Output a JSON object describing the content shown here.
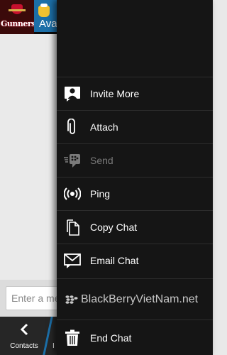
{
  "header": {
    "avatar_text": "Gunners",
    "contact_name": "Avai"
  },
  "composer": {
    "placeholder": "Enter a me"
  },
  "bottom_bar": {
    "back_label": "Contacts",
    "next_label": "I"
  },
  "menu": {
    "items": [
      {
        "label": "Invite More",
        "icon": "invite-contact-icon",
        "enabled": true
      },
      {
        "label": "Attach",
        "icon": "paperclip-icon",
        "enabled": true
      },
      {
        "label": "Send",
        "icon": "blackberry-send-icon",
        "enabled": false
      },
      {
        "label": "Ping",
        "icon": "ping-icon",
        "enabled": true
      },
      {
        "label": "Copy Chat",
        "icon": "copy-document-icon",
        "enabled": true
      },
      {
        "label": "Email Chat",
        "icon": "email-icon",
        "enabled": true
      }
    ],
    "watermark": "BlackBerryVietNam.net",
    "end_item": {
      "label": "End Chat",
      "icon": "trash-icon"
    }
  },
  "colors": {
    "menu_background": "#151515",
    "menu_divider": "#2c2c2c",
    "accent": "#1c6fa8",
    "disabled_text": "#7a7a7a"
  }
}
